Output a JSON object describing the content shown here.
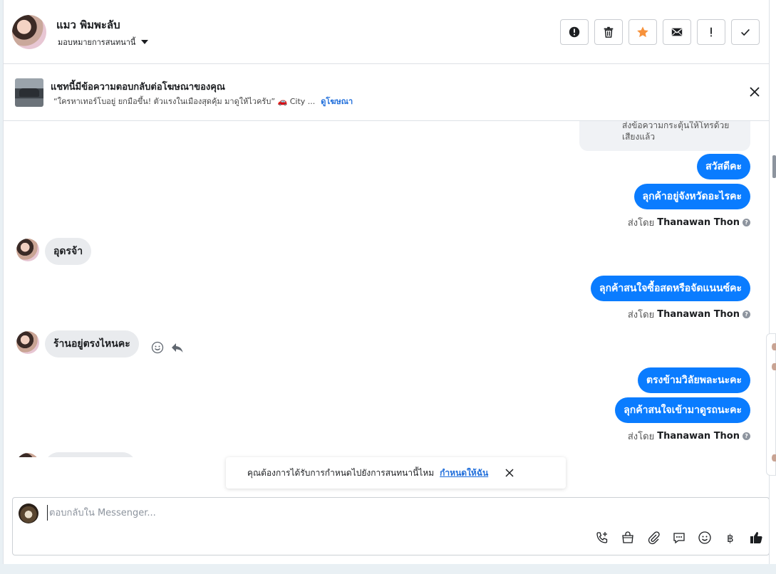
{
  "contact": {
    "name": "แมว พิมพะลับ",
    "assign_label": "มอบหมายการสนทนานี้"
  },
  "header_actions": [
    {
      "name": "report-spam",
      "icon": "exclamation-circle-icon"
    },
    {
      "name": "delete",
      "icon": "trash-icon"
    },
    {
      "name": "star",
      "icon": "star-icon",
      "color": "#f7923b"
    },
    {
      "name": "mark-unread",
      "icon": "envelope-icon"
    },
    {
      "name": "follow-up",
      "icon": "exclamation-icon"
    },
    {
      "name": "done",
      "icon": "checkmark-icon"
    }
  ],
  "ad_banner": {
    "title": "แชทนี้มีข้อความตอบกลับต่อโฆษณาของคุณ",
    "description": "“ใครหาเทอร์โบอยู่ ยกมือขึ้น! ตัวแรงในเมืองสุดคุ้ม มาดูให้ไวครับ” 🚗 City ...",
    "link": "ดูโฆษณา"
  },
  "messages": {
    "system_partial": "ส่งข้อความกระตุ้นให้โทรด้วยเสียงแล้ว",
    "out_1": "สวัสดีคะ",
    "out_2": "ลุกค้าอยู่จังหวัดอะไรคะ",
    "in_1": "อุดรจ้า",
    "out_3": "ลุกค้าสนใจซื้อสดหรือจัดแนนซ์คะ",
    "in_2": "ร้านอยู่ตรงไหนคะ",
    "out_4": "ตรงข้ามวิลัยพละนะคะ",
    "out_5": "ลุกค้าสนใจเข้ามาดูรถนะคะ",
    "sent_by_prefix": "ส่งโดย",
    "sent_by_name": "Thanawan Thon"
  },
  "toast": {
    "text": "คุณต้องการได้รับการกำหนดไปยังการสนทนานี้ไหม",
    "link": "กำหนดให้ฉัน"
  },
  "reply": {
    "placeholder": "ตอบกลับใน Messenger...",
    "tools": [
      "phone-plus-icon",
      "shopping-bag-icon",
      "paperclip-icon",
      "saved-reply-icon",
      "emoji-icon",
      "baht-icon",
      "thumbs-up-icon"
    ]
  },
  "colors": {
    "accent": "#0a7cff",
    "link": "#216fdb",
    "star": "#f7923b"
  }
}
